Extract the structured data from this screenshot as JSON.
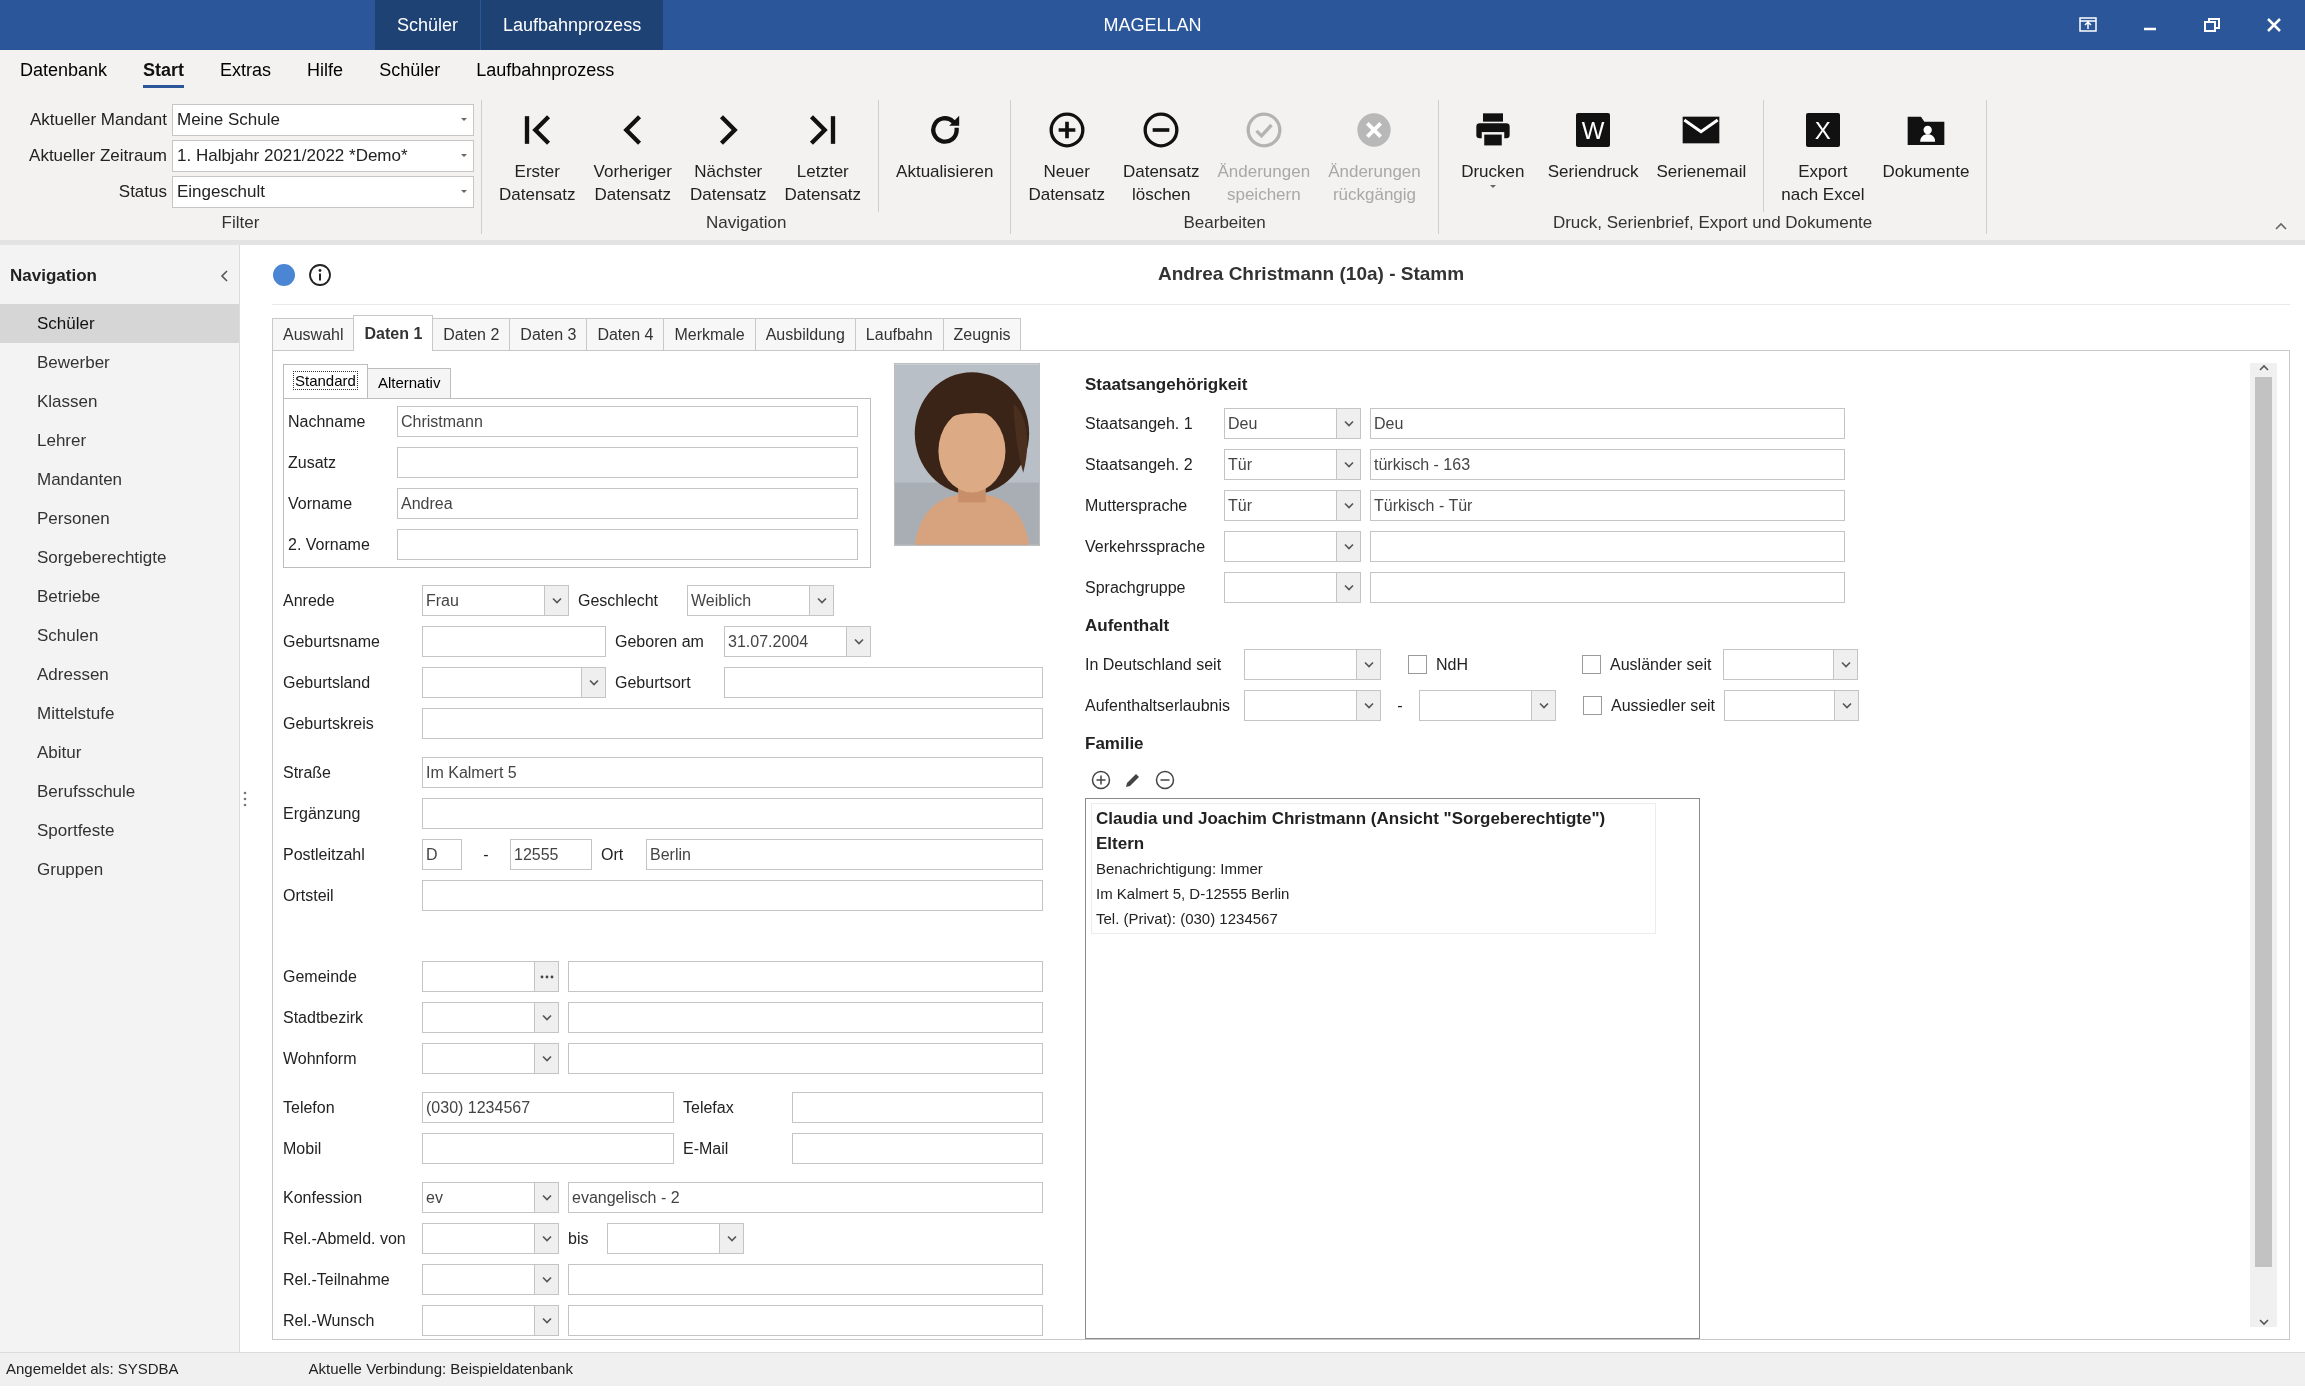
{
  "window": {
    "title": "MAGELLAN",
    "context_tabs": [
      "Schüler",
      "Laufbahnprozess"
    ]
  },
  "menu": [
    {
      "label": "Datenbank",
      "selected": false
    },
    {
      "label": "Start",
      "selected": true
    },
    {
      "label": "Extras",
      "selected": false
    },
    {
      "label": "Hilfe",
      "selected": false
    },
    {
      "label": "Schüler",
      "selected": false
    },
    {
      "label": "Laufbahnprozess",
      "selected": false
    }
  ],
  "ribbon": {
    "filter": {
      "label": "Filter",
      "fields": [
        {
          "label": "Aktueller Mandant",
          "value": "Meine Schule"
        },
        {
          "label": "Aktueller Zeitraum",
          "value": "1. Halbjahr 2021/2022 *Demo*"
        },
        {
          "label": "Status",
          "value": "Eingeschult"
        }
      ]
    },
    "groups": [
      {
        "label": "Navigation",
        "clusters": [
          [
            {
              "lines": [
                "Erster",
                "Datensatz"
              ],
              "disabled": false
            },
            {
              "lines": [
                "Vorheriger",
                "Datensatz"
              ],
              "disabled": false
            },
            {
              "lines": [
                "Nächster",
                "Datensatz"
              ],
              "disabled": false
            },
            {
              "lines": [
                "Letzter",
                "Datensatz"
              ],
              "disabled": false
            }
          ],
          [
            {
              "lines": [
                "Aktualisieren"
              ],
              "disabled": false
            }
          ]
        ]
      },
      {
        "label": "Bearbeiten",
        "clusters": [
          [
            {
              "lines": [
                "Neuer",
                "Datensatz"
              ],
              "disabled": false
            },
            {
              "lines": [
                "Datensatz",
                "löschen"
              ],
              "disabled": false
            },
            {
              "lines": [
                "Änderungen",
                "speichern"
              ],
              "disabled": true
            },
            {
              "lines": [
                "Änderungen",
                "rückgängig"
              ],
              "disabled": true
            }
          ]
        ]
      },
      {
        "label": "Druck, Serienbrief, Export und Dokumente",
        "clusters": [
          [
            {
              "lines": [
                "Drucken"
              ],
              "disabled": false,
              "has_menu": true
            },
            {
              "lines": [
                "Seriendruck"
              ],
              "disabled": false,
              "icon_text": "W"
            },
            {
              "lines": [
                "Serienemail"
              ],
              "disabled": false
            }
          ],
          [
            {
              "lines": [
                "Export",
                "nach Excel"
              ],
              "disabled": false,
              "icon_text": "X"
            },
            {
              "lines": [
                "Dokumente"
              ],
              "disabled": false
            }
          ]
        ]
      }
    ]
  },
  "navigation": {
    "title": "Navigation",
    "items": [
      {
        "label": "Schüler",
        "selected": true
      },
      {
        "label": "Bewerber",
        "selected": false
      },
      {
        "label": "Klassen",
        "selected": false
      },
      {
        "label": "Lehrer",
        "selected": false
      },
      {
        "label": "Mandanten",
        "selected": false
      },
      {
        "label": "Personen",
        "selected": false
      },
      {
        "label": "Sorgeberechtigte",
        "selected": false
      },
      {
        "label": "Betriebe",
        "selected": false
      },
      {
        "label": "Schulen",
        "selected": false
      },
      {
        "label": "Adressen",
        "selected": false
      },
      {
        "label": "Mittelstufe",
        "selected": false
      },
      {
        "label": "Abitur",
        "selected": false
      },
      {
        "label": "Berufsschule",
        "selected": false
      },
      {
        "label": "Sportfeste",
        "selected": false
      },
      {
        "label": "Gruppen",
        "selected": false
      }
    ]
  },
  "record": {
    "title": "Andrea Christmann (10a) - Stamm"
  },
  "tabs": [
    {
      "label": "Auswahl",
      "selected": false
    },
    {
      "label": "Daten 1",
      "selected": true
    },
    {
      "label": "Daten 2",
      "selected": false
    },
    {
      "label": "Daten 3",
      "selected": false
    },
    {
      "label": "Daten 4",
      "selected": false
    },
    {
      "label": "Merkmale",
      "selected": false
    },
    {
      "label": "Ausbildung",
      "selected": false
    },
    {
      "label": "Laufbahn",
      "selected": false
    },
    {
      "label": "Zeugnis",
      "selected": false
    }
  ],
  "subtabs": [
    {
      "label": "Standard",
      "selected": true
    },
    {
      "label": "Alternativ",
      "selected": false
    }
  ],
  "name_fields": [
    {
      "label": "Nachname",
      "value": "Christmann"
    },
    {
      "label": "Zusatz"
    },
    {
      "label": "Vorname",
      "value": "Andrea"
    },
    {
      "label": "2. Vorname"
    }
  ],
  "form_left": [
    [
      [
        {
          "kind": "label",
          "text": "Anrede"
        },
        {
          "kind": "combo",
          "value": "Frau"
        },
        {
          "kind": "label",
          "text": "Geschlecht"
        },
        {
          "kind": "combo",
          "value": "Weiblich"
        }
      ],
      [
        {
          "kind": "label",
          "text": "Geburtsname"
        },
        {
          "kind": "text"
        },
        {
          "kind": "label",
          "text": "Geboren am"
        },
        {
          "kind": "combo",
          "value": "31.07.2004"
        }
      ],
      [
        {
          "kind": "label",
          "text": "Geburtsland"
        },
        {
          "kind": "combo"
        },
        {
          "kind": "label",
          "text": "Geburtsort"
        },
        {
          "kind": "text"
        }
      ],
      [
        {
          "kind": "label",
          "text": "Geburtskreis"
        },
        {
          "kind": "text"
        }
      ]
    ],
    [
      [
        {
          "kind": "label",
          "text": "Straße"
        },
        {
          "kind": "text",
          "value": "Im Kalmert 5"
        }
      ],
      [
        {
          "kind": "label",
          "text": "Ergänzung"
        },
        {
          "kind": "text"
        }
      ],
      [
        {
          "kind": "label",
          "text": "Postleitzahl"
        },
        {
          "kind": "text",
          "value": "D"
        },
        {
          "kind": "dash",
          "text": "-"
        },
        {
          "kind": "text",
          "value": "12555"
        },
        {
          "kind": "label",
          "text": "Ort"
        },
        {
          "kind": "text",
          "value": "Berlin"
        }
      ],
      [
        {
          "kind": "label",
          "text": "Ortsteil"
        },
        {
          "kind": "text"
        }
      ]
    ],
    [
      [
        {
          "kind": "label",
          "text": "Gemeinde"
        },
        {
          "kind": "ellipsis"
        },
        {
          "kind": "text"
        }
      ],
      [
        {
          "kind": "label",
          "text": "Stadtbezirk"
        },
        {
          "kind": "combo"
        },
        {
          "kind": "text"
        }
      ],
      [
        {
          "kind": "label",
          "text": "Wohnform"
        },
        {
          "kind": "combo"
        },
        {
          "kind": "text"
        }
      ]
    ],
    [
      [
        {
          "kind": "label",
          "text": "Telefon"
        },
        {
          "kind": "text",
          "value": "(030) 1234567"
        },
        {
          "kind": "label",
          "text": "Telefax"
        },
        {
          "kind": "text"
        }
      ],
      [
        {
          "kind": "label",
          "text": "Mobil"
        },
        {
          "kind": "text"
        },
        {
          "kind": "label",
          "text": "E-Mail"
        },
        {
          "kind": "text"
        }
      ]
    ],
    [
      [
        {
          "kind": "label",
          "text": "Konfession"
        },
        {
          "kind": "combo",
          "value": "ev"
        },
        {
          "kind": "text",
          "value": "evangelisch - 2"
        }
      ],
      [
        {
          "kind": "label",
          "text": "Rel.-Abmeld. von"
        },
        {
          "kind": "combo"
        },
        {
          "kind": "label",
          "text": "bis"
        },
        {
          "kind": "combo"
        }
      ],
      [
        {
          "kind": "label",
          "text": "Rel.-Teilnahme"
        },
        {
          "kind": "combo"
        },
        {
          "kind": "text"
        }
      ],
      [
        {
          "kind": "label",
          "text": "Rel.-Wunsch"
        },
        {
          "kind": "combo"
        },
        {
          "kind": "text"
        }
      ]
    ]
  ],
  "form_right": [
    {
      "heading": "Staatsangehörigkeit",
      "rows": [
        [
          {
            "kind": "label",
            "text": "Staatsangeh. 1"
          },
          {
            "kind": "combo",
            "value": "Deu"
          },
          {
            "kind": "text",
            "value": "Deu"
          }
        ],
        [
          {
            "kind": "label",
            "text": "Staatsangeh. 2"
          },
          {
            "kind": "combo",
            "value": "Tür"
          },
          {
            "kind": "text",
            "value": "türkisch - 163"
          }
        ],
        [
          {
            "kind": "label",
            "text": "Muttersprache"
          },
          {
            "kind": "combo",
            "value": "Tür"
          },
          {
            "kind": "text",
            "value": "Türkisch - Tür"
          }
        ],
        [
          {
            "kind": "label",
            "text": "Verkehrssprache"
          },
          {
            "kind": "combo"
          },
          {
            "kind": "text"
          }
        ],
        [
          {
            "kind": "label",
            "text": "Sprachgruppe"
          },
          {
            "kind": "combo"
          },
          {
            "kind": "text"
          }
        ]
      ]
    },
    {
      "heading": "Aufenthalt",
      "rows": [
        [
          {
            "kind": "label",
            "text": "In Deutschland seit"
          },
          {
            "kind": "combo"
          },
          {
            "kind": "check",
            "text": "NdH",
            "checked": false
          },
          {
            "kind": "check",
            "text": "Ausländer seit",
            "checked": false
          },
          {
            "kind": "combo"
          }
        ],
        [
          {
            "kind": "label",
            "text": "Aufenthaltserlaubnis"
          },
          {
            "kind": "combo"
          },
          {
            "kind": "dash",
            "text": "-"
          },
          {
            "kind": "combo"
          },
          {
            "kind": "check",
            "text": "Aussiedler seit",
            "checked": false
          },
          {
            "kind": "combo"
          }
        ]
      ]
    }
  ],
  "family": {
    "heading": "Familie",
    "entries": [
      {
        "title": "Claudia und Joachim Christmann (Ansicht \"Sorgeberechtigte\")",
        "role": "Eltern",
        "lines": [
          "Benachrichtigung: Immer",
          "Im Kalmert 5, D-12555 Berlin",
          "Tel. (Privat): (030) 1234567"
        ]
      }
    ]
  },
  "status_bar": [
    "Angemeldet als: SYSDBA",
    "Aktuelle Verbindung: Beispieldatenbank"
  ]
}
